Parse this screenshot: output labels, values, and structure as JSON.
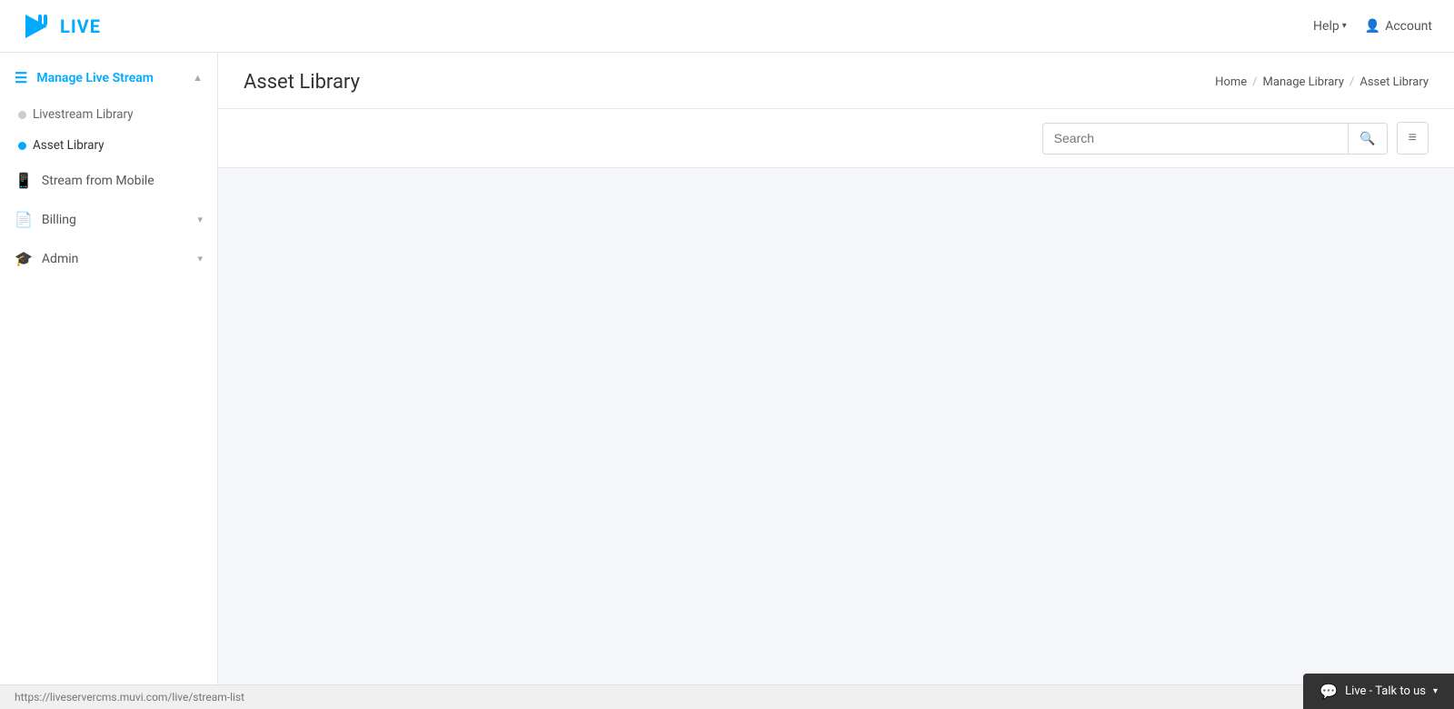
{
  "app": {
    "logo_text": "LIVE",
    "logo_icon": "▶"
  },
  "header": {
    "help_label": "Help",
    "account_label": "Account",
    "account_icon": "👤"
  },
  "sidebar": {
    "manage_live_stream_label": "Manage Live Stream",
    "manage_icon": "☰",
    "sub_items": [
      {
        "label": "Livestream Library",
        "active": false
      },
      {
        "label": "Asset Library",
        "active": true
      }
    ],
    "main_items": [
      {
        "label": "Stream from Mobile",
        "icon": "📱"
      },
      {
        "label": "Billing",
        "icon": "📄",
        "has_chevron": true
      },
      {
        "label": "Admin",
        "icon": "🎓",
        "has_chevron": true
      }
    ]
  },
  "breadcrumb": {
    "home": "Home",
    "manage_library": "Manage Library",
    "asset_library": "Asset Library"
  },
  "page": {
    "title": "Asset Library"
  },
  "toolbar": {
    "search_placeholder": "Search",
    "search_icon": "🔍",
    "sort_icon": "≡"
  },
  "status_bar": {
    "url": "https://liveservercms.muvi.com/live/stream-list"
  },
  "chat_widget": {
    "label": "Live - Talk to us",
    "icon": "💬"
  }
}
